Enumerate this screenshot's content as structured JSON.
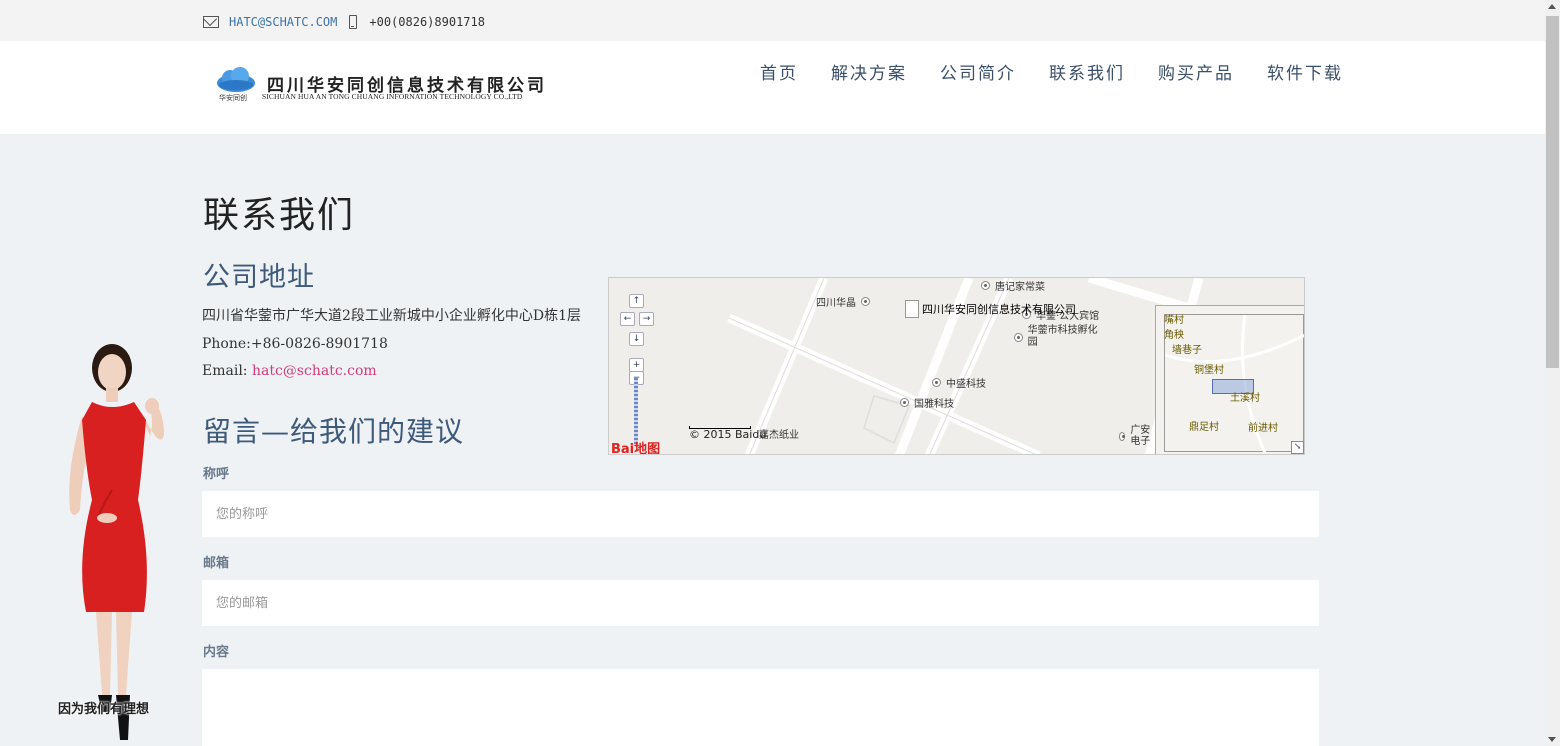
{
  "topbar": {
    "email": "HATC@SCHATC.COM",
    "phone": "+00(0826)8901718"
  },
  "logo": {
    "name_cn": "四川华安同创信息技术有限公司",
    "name_en": "SICHUAN HUA AN TONG CHUANG INFORNATION TECHNOLOGY CO.,LTD",
    "badge": "华安同创"
  },
  "nav": [
    "首页",
    "解决方案",
    "公司简介",
    "联系我们",
    "购买产品",
    "软件下载"
  ],
  "page": {
    "title": "联系我们",
    "address_title": "公司地址",
    "address_line": "四川省华蓥市广华大道2段工业新城中小企业孵化中心D栋1层",
    "phone_line": "Phone:+86-0826-8901718",
    "email_label": "Email: ",
    "email_value": "hatc@schatc.com"
  },
  "form": {
    "title": "留言—给我们的建议",
    "name_label": "称呼",
    "name_placeholder": "您的称呼",
    "email_label": "邮箱",
    "email_placeholder": "您的邮箱",
    "content_label": "内容",
    "content_value": ""
  },
  "map": {
    "marker_label": "四川华安同创信息技术有限公司",
    "copyright": "© 2015 Baidu",
    "brand": "Bai地图",
    "controls": {
      "up": "↑",
      "left": "←",
      "right": "→",
      "down": "↓",
      "zoom_in": "+",
      "zoom_out": "−"
    },
    "pois": [
      "唐记家常菜",
      "四川华晶",
      "华蓥·公大宾馆",
      "华蓥市科技孵化园",
      "中盛科技",
      "国雅科技",
      "嘉杰纸业",
      "广安电子"
    ],
    "minimap_labels": [
      "嘴村",
      "角秧",
      "墙巷子",
      "铜堡村",
      "土溪村",
      "鼎足村",
      "前进村"
    ],
    "minimap_toggle": "↘"
  },
  "mascot": {
    "caption": "因为我们有理想"
  },
  "colors": {
    "accent": "#3d5a7a",
    "link": "#d03b79",
    "dress": "#d82020"
  }
}
